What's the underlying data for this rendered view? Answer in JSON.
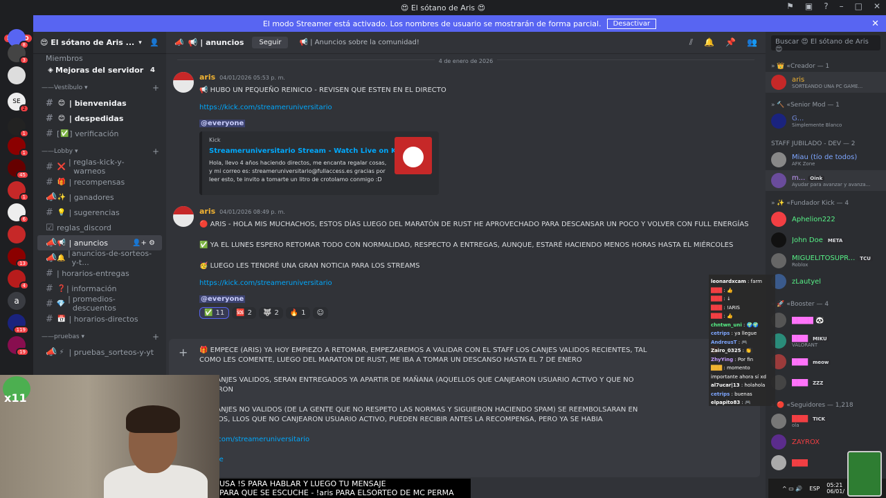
{
  "window": {
    "title": "😍 El sótano de Aris 😍"
  },
  "banner": {
    "text": "El modo Streamer está activado. Los nombres de usuario se mostrarán de forma parcial.",
    "button": "Desactivar"
  },
  "servers": {
    "new_label": "NUEVO",
    "badges": [
      "8",
      "3",
      "2",
      "1",
      "1",
      "45",
      "1",
      "6",
      "13",
      "4",
      "119",
      "19"
    ],
    "text_icon": "a"
  },
  "sidebar": {
    "server_name": "😍 El sótano de Aris ...",
    "top_items": [
      {
        "label": "Miembros"
      },
      {
        "label": "Mejoras del servidor",
        "count": "4"
      }
    ],
    "categories": [
      {
        "name": "Vestíbulo",
        "channels": [
          {
            "emoji": "😊",
            "label": "bienvenidas",
            "bold": true
          },
          {
            "emoji": "😊",
            "label": "despedidas",
            "bold": true
          },
          {
            "emoji": "✅",
            "label": "verificación"
          }
        ]
      },
      {
        "name": "Lobby",
        "channels": [
          {
            "emoji": "❌",
            "label": "reglas-kick-y-warneos"
          },
          {
            "emoji": "🎁",
            "label": "recompensas"
          },
          {
            "emoji": "✨",
            "label": "ganadores"
          },
          {
            "emoji": "💡",
            "label": "sugerencias"
          },
          {
            "emoji": "",
            "label": "reglas_discord"
          },
          {
            "emoji": "📢",
            "label": "anuncios",
            "active": true
          },
          {
            "emoji": "🔔",
            "label": "anuncios-de-sorteos-y-t..."
          },
          {
            "emoji": "",
            "label": "horarios-entregas"
          },
          {
            "emoji": "❓",
            "label": "información"
          },
          {
            "emoji": "💎",
            "label": "promedios-descuentos"
          },
          {
            "emoji": "📅",
            "label": "horarios-directos"
          }
        ]
      },
      {
        "name": "pruebas",
        "channels": [
          {
            "emoji": "⚡",
            "label": "pruebas_sorteos-y-yt"
          }
        ]
      }
    ]
  },
  "channel_header": {
    "name": "anuncios",
    "follow": "Seguir",
    "topic": "📢 | Anuncios sobre la comunidad!"
  },
  "search": {
    "placeholder": "Buscar 😍 El sótano de Aris 😍"
  },
  "messages": {
    "date_divider": "4 de enero de 2026",
    "m1": {
      "author": "aris",
      "timestamp": "04/01/2026 05:53 p. m.",
      "text": "📢 HUBO UN PEQUEÑO REINICIO - REVISEN QUE ESTEN EN EL DIRECTO",
      "link": "https://kick.com/streameruniversitario",
      "mention": "@everyone",
      "embed": {
        "provider": "Kick",
        "title": "Streameruniversitario Stream - Watch Live on Kick",
        "description": "Hola, llevo 4 años haciendo directos, me encanta regalar cosas, y mi correo es: streameruniversitario@fullaccess.es gracias por leer esto, te invito a tomarte un litro de crotolamo conmigo :D"
      }
    },
    "m2": {
      "author": "aris",
      "timestamp": "04/01/2026 08:49 p. m.",
      "line1": "🔴 ARIS - HOLA MIS MUCHACHOS, ESTOS DÍAS LUEGO DEL MARATÓN DE RUST HE APROVECHADO PARA DESCANSAR UN POCO Y VOLVER CON FULL ENERGÍAS",
      "line2": "✅ YA EL LUNES ESPERO RETOMAR TODO CON NORMALIDAD, RESPECTO A ENTREGAS, AUNQUE, ESTARÉ HACIENDO MENOS HORAS HASTA EL MIÉRCOLES",
      "line3": "🥳 LUEGO LES TENDRÉ UNA GRAN NOTICIA PARA LOS STREAMS",
      "link": "https://kick.com/streameruniversitario",
      "mention": "@everyone",
      "reactions": [
        {
          "emoji": "✅",
          "count": "11"
        },
        {
          "emoji": "🆘",
          "count": "2"
        },
        {
          "emoji": "🐺",
          "count": "2"
        },
        {
          "emoji": "🔥",
          "count": "1"
        }
      ]
    }
  },
  "composer": {
    "p1": "🎁 EMPECE (ARIS) YA HOY EMPIEZO A RETOMAR, EMPEZAREMOS A VALIDAR CON EL STAFF LOS CANJES VALIDOS RECIENTES, TAL COMO LES COMENTE, LUEGO DEL MARATON DE RUST, ME IBA A TOMAR UN DESCANSO HASTA EL 7 DE ENERO",
    "p2": "OS CANJES VALIDOS, SERAN ENTREGADOS YA APARTIR DE MAÑANA (AQUELLOS QUE CANJEARON USUARIO ACTIVO Y QUE NO HICIERON",
    "p3": "OS CANJES NO VALIDOS (DE LA GENTE QUE NO RESPETO LAS NORMAS Y SIGUIERON HACIENDO SPAM) SE REEMBOLSARAN EN PUNTOS, LLOS QUE NO CANJEARON USUARIO ACTIVO, PUEDEN RECIBIR ANTES LA RECOMPENSA, PERO YA SE HABIA",
    "link": "/kick.com/streameruniversitario",
    "mention": "eryone"
  },
  "members": {
    "groups": [
      {
        "title": "Creador — 1",
        "members": [
          {
            "name": "aris",
            "status": "SORTEANDO UNA PC GAME...",
            "color": "#f0b232"
          }
        ]
      },
      {
        "title": "Senior Mod — 1",
        "members": [
          {
            "name": "G...",
            "status": "Simplemente Blanco",
            "color": "#5865f2"
          }
        ]
      },
      {
        "title": "STAFF JUBILADO - DEV — 2",
        "members": [
          {
            "name": "Miau (tío de todos)",
            "status": "AFK Zone",
            "color": "#7ea6ff"
          },
          {
            "name": "m...",
            "tag": "Oink",
            "status": "Ayudar para avanzar y avanza...",
            "color": "#c59bff"
          }
        ]
      },
      {
        "title": "Fundador Kick — 4",
        "members": [
          {
            "name": "Aphelion222",
            "color": "#57f287"
          },
          {
            "name": "John Doe",
            "tag": "META",
            "color": "#57f287"
          },
          {
            "name": "MIGUELITOSUPR...",
            "tag": "TCU",
            "status": "Roblox",
            "color": "#57f287"
          },
          {
            "name": "zLautyel",
            "color": "#57f287"
          }
        ]
      },
      {
        "title": "Booster — 4",
        "members": [
          {
            "name": "",
            "status": "",
            "color": "#ff73fa"
          },
          {
            "name": "",
            "tag": "MIKU",
            "status": "VALORANT",
            "color": "#ff73fa"
          },
          {
            "name": "",
            "tag": "meow",
            "color": "#ff73fa"
          },
          {
            "name": "",
            "tag": "ZZZ",
            "color": "#ff73fa"
          }
        ]
      },
      {
        "title": "Seguidores — 1,218",
        "members": [
          {
            "name": "",
            "tag": "TICK",
            "status": "ola",
            "color": "#f23f43"
          },
          {
            "name": "ZAYROX",
            "color": "#f23f43"
          },
          {
            "name": "",
            "color": "#f23f43"
          }
        ]
      }
    ]
  },
  "chat_overlay": {
    "lines": [
      {
        "user": "leonardxcam",
        "text": "farm"
      },
      {
        "user": "",
        "text": ""
      },
      {
        "user": "",
        "text": ""
      },
      {
        "user": "",
        "text": "!ARIS"
      },
      {
        "user": "",
        "text": ""
      },
      {
        "user": "chntwn_uni",
        "text": ""
      },
      {
        "user": "cetrips",
        "text": "ya llegue"
      },
      {
        "user": "AndreusT",
        "text": ""
      },
      {
        "user": "Zairo_0325",
        "text": ""
      },
      {
        "user": "ZhyYing",
        "text": "Por fin"
      },
      {
        "user": "",
        "text": "momento importante ahora sí xd"
      },
      {
        "user": "al7ucar|13",
        "text": "holahola"
      },
      {
        "user": "cetrips",
        "text": "buenas"
      },
      {
        "user": "elpapito83",
        "text": ""
      }
    ]
  },
  "stream": {
    "sub_count": "x11",
    "subtitle": "USA !S PARA HABLAR Y LUEGO TU MENSAJE\nPARA QUE SE ESCUCHE - !aris PARA ELSORTEO DE MC PERMA"
  },
  "taskbar": {
    "lang": "ESP",
    "time": "05:21",
    "date": "06/01/"
  }
}
